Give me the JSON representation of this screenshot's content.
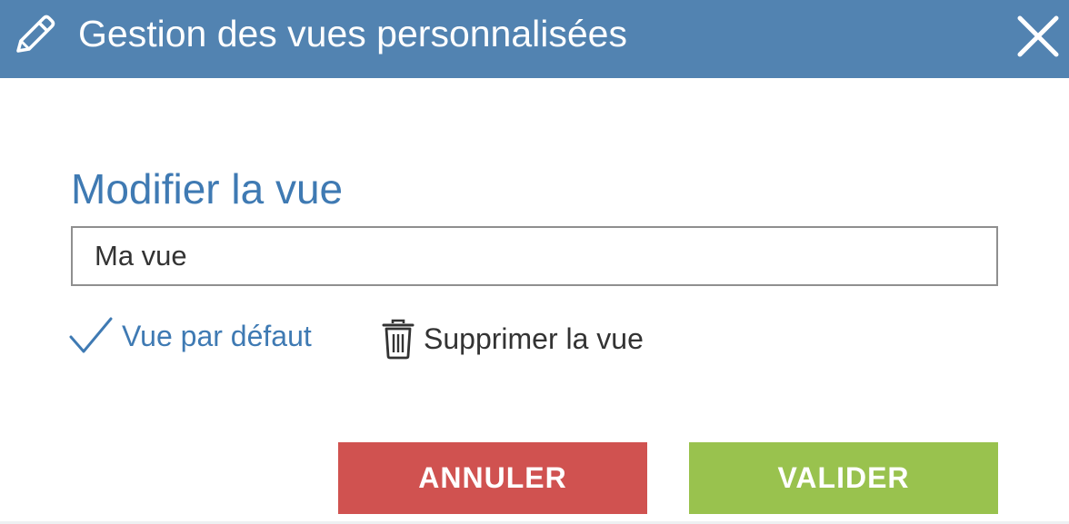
{
  "dialog": {
    "title": "Gestion des vues personnalisées",
    "header_icon": "pencil-icon",
    "close_icon": "close-icon",
    "header_color": "#5283b1"
  },
  "form": {
    "section_title": "Modifier la vue",
    "view_name_value": "Ma vue",
    "default_view_label": "Vue par défaut",
    "default_view_icon": "checkmark-icon",
    "delete_view_label": "Supprimer la vue",
    "delete_view_icon": "trash-icon",
    "accent_color": "#3f7ab3"
  },
  "actions": {
    "cancel_label": "ANNULER",
    "cancel_color": "#d05250",
    "validate_label": "VALIDER",
    "validate_color": "#99c24e"
  }
}
